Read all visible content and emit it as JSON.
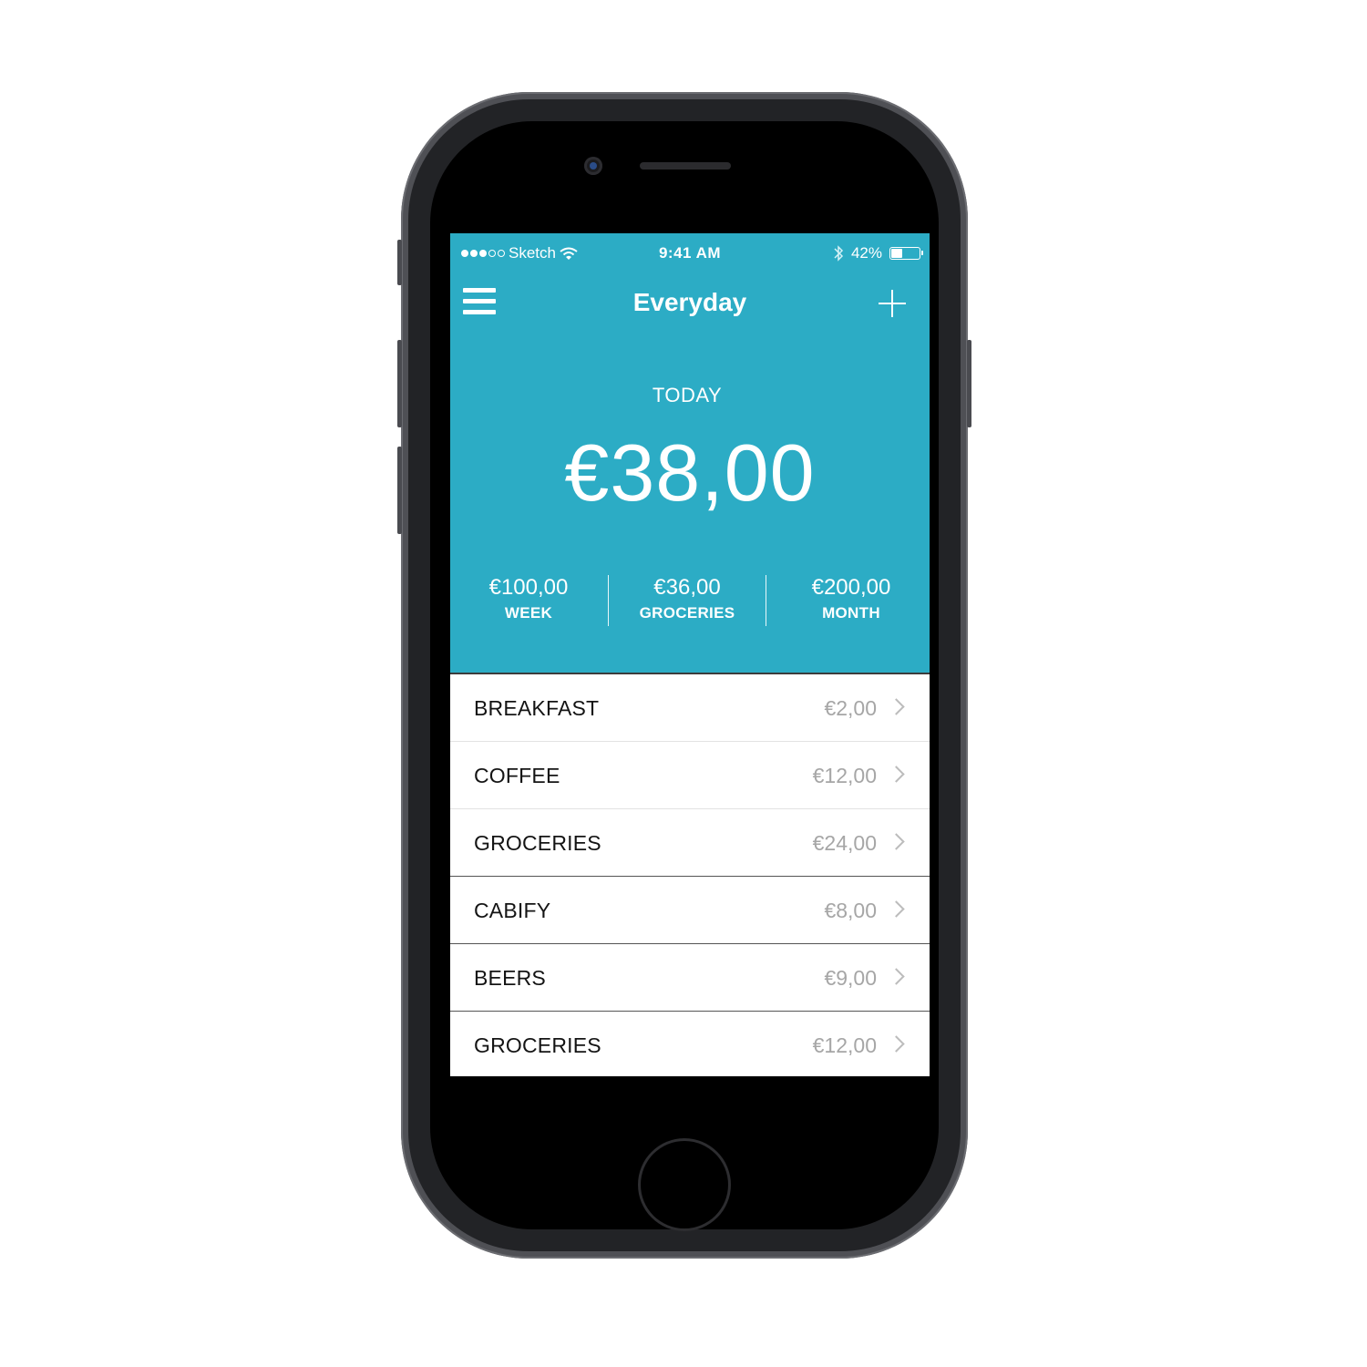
{
  "status_bar": {
    "carrier": "Sketch",
    "time": "9:41 AM",
    "battery": "42%",
    "battery_level": 0.42,
    "signal_strength": 3
  },
  "nav": {
    "title": "Everyday",
    "menu_icon": "hamburger-menu-icon",
    "add_icon": "plus-icon"
  },
  "summary": {
    "label": "TODAY",
    "amount": "€38,00",
    "stats": [
      {
        "value": "€100,00",
        "label": "WEEK"
      },
      {
        "value": "€36,00",
        "label": "GROCERIES"
      },
      {
        "value": "€200,00",
        "label": "MONTH"
      }
    ]
  },
  "expenses": [
    {
      "name": "BREAKFAST",
      "amount": "€2,00"
    },
    {
      "name": "COFFEE",
      "amount": "€12,00"
    },
    {
      "name": "GROCERIES",
      "amount": "€24,00"
    },
    {
      "name": "CABIFY",
      "amount": "€8,00"
    },
    {
      "name": "BEERS",
      "amount": "€9,00"
    },
    {
      "name": "GROCERIES",
      "amount": "€12,00"
    }
  ],
  "colors": {
    "accent": "#2cacc5",
    "amount_text": "#a6a6a6",
    "phone_body": "#4f5055"
  }
}
